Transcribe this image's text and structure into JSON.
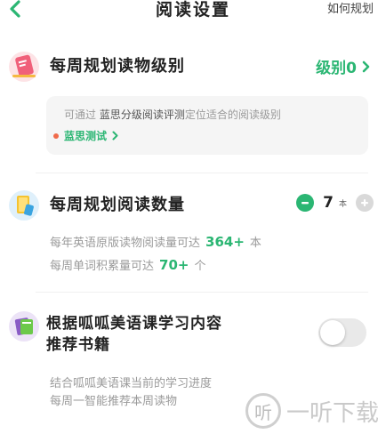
{
  "header": {
    "title": "阅读设置",
    "right_link": "如何规划"
  },
  "section1": {
    "title": "每周规划读物级别",
    "level_value": "级别0",
    "info": {
      "prefix": "可通过 ",
      "highlight": "蓝思分级阅读评测",
      "suffix": "定位适合的阅读级别",
      "test_link": "蓝思测试"
    }
  },
  "section2": {
    "title": "每周规划阅读数量",
    "stepper": {
      "value": "7",
      "unit": "本"
    },
    "stats": [
      {
        "prefix": "每年英语原版读物阅读量可达",
        "number": "364+",
        "suffix": "本"
      },
      {
        "prefix": "每周单词积累量可达",
        "number": "70+",
        "suffix": "个"
      }
    ]
  },
  "section3": {
    "title_line1": "根据呱呱美语课学习内容",
    "title_line2": "推荐书籍",
    "toggle_on": false,
    "desc_line1": "结合呱呱美语课当前的学习进度",
    "desc_line2": "每周一智能推荐本周读物"
  },
  "watermark": {
    "glyph": "听",
    "text": "一听下载"
  },
  "colors": {
    "accent_green": "#2bb673",
    "red_dot": "#f06a4a"
  }
}
